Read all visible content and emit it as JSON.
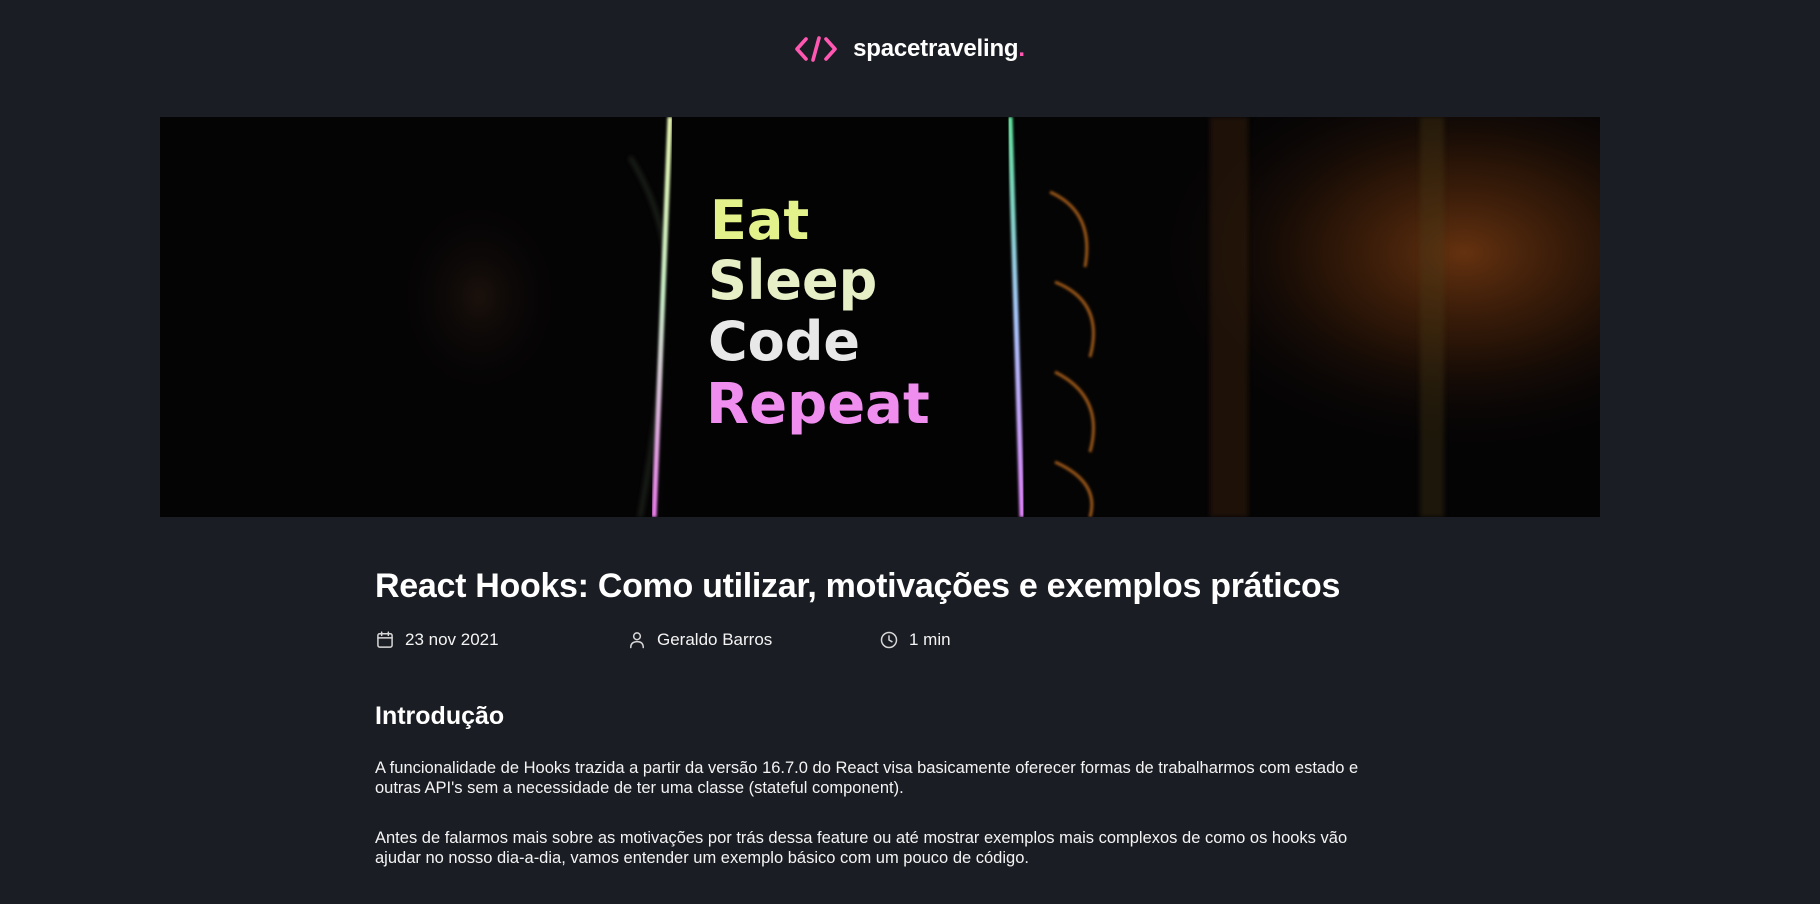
{
  "header": {
    "logo_icon": "code-brackets-icon",
    "brand_name": "spacetraveling",
    "brand_dot": ".",
    "accent_color": "#ff57b2"
  },
  "banner": {
    "alt_words": [
      "Eat",
      "Sleep",
      "Code",
      "Repeat"
    ]
  },
  "post": {
    "title": "React Hooks: Como utilizar, motivações e exemplos práticos",
    "date_icon": "calendar-icon",
    "date": "23 nov 2021",
    "author_icon": "user-icon",
    "author": "Geraldo Barros",
    "reading_time_icon": "clock-icon",
    "reading_time": "1 min",
    "sections": [
      {
        "heading": "Introdução",
        "paragraphs": [
          "A funcionalidade de Hooks trazida a partir da versão 16.7.0 do React visa basicamente oferecer formas de trabalharmos com estado e outras API's sem a necessidade de ter uma classe (stateful component).",
          "Antes de falarmos mais sobre as motivações por trás dessa feature ou até mostrar exemplos mais complexos de como os hooks vão ajudar no nosso dia-a-dia, vamos entender um exemplo básico com um pouco de código."
        ]
      }
    ]
  }
}
